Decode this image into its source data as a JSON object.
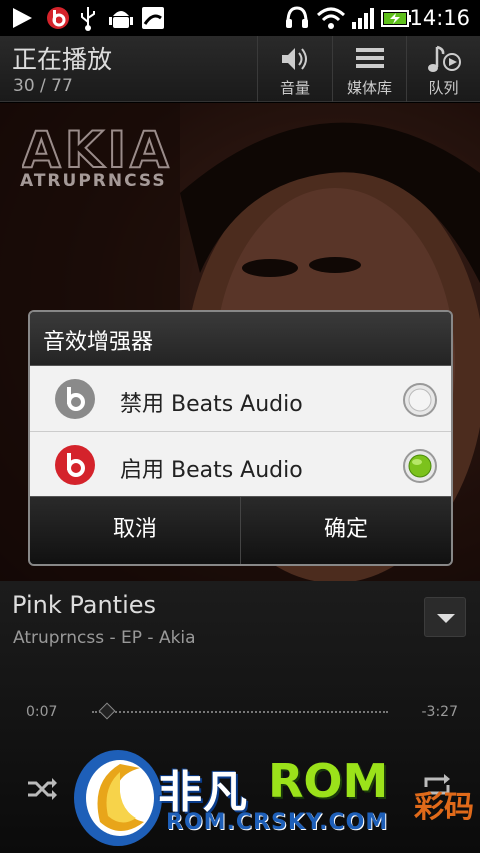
{
  "status_bar": {
    "time": "14:16",
    "icons": [
      "play-icon",
      "beats-icon",
      "usb-icon",
      "android-debug-icon",
      "sd-card-icon",
      "headset-icon",
      "wifi-icon",
      "signal-icon",
      "battery-charging-icon"
    ]
  },
  "action_bar": {
    "title": "正在播放",
    "track_counter": "30 / 77",
    "buttons": [
      {
        "label": "音量",
        "icon": "volume-icon"
      },
      {
        "label": "媒体库",
        "icon": "library-icon"
      },
      {
        "label": "队列",
        "icon": "queue-icon"
      }
    ]
  },
  "album_art": {
    "logo_text": "AKIA",
    "subtitle": "ATRUPRNCSS"
  },
  "dialog": {
    "title": "音效增强器",
    "options": [
      {
        "label": "禁用 Beats Audio",
        "icon": "beats-grey-icon",
        "selected": false
      },
      {
        "label": "启用 Beats Audio",
        "icon": "beats-red-icon",
        "selected": true
      }
    ],
    "cancel_label": "取消",
    "ok_label": "确定"
  },
  "now_playing": {
    "song": "Pink Panties",
    "album_artist": "Atruprncss - EP - Akia",
    "elapsed": "0:07",
    "remaining": "-3:27",
    "progress": 0.03
  },
  "watermark": {
    "cn_text": "非凡",
    "rom_text": "ROM",
    "url": "ROM.CRSKY.COM",
    "extra": "彩码"
  },
  "colors": {
    "beats_red": "#d4232b",
    "radio_green": "#7cc21c",
    "dialog_bg": "#f2f2f2"
  }
}
